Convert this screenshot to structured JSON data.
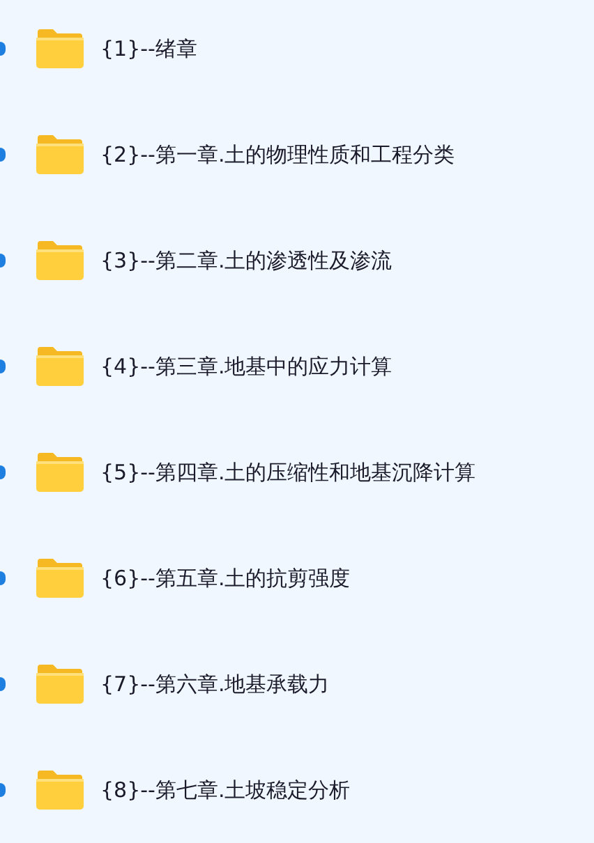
{
  "folders": [
    {
      "label": "{1}--绪章"
    },
    {
      "label": "{2}--第一章.土的物理性质和工程分类"
    },
    {
      "label": "{3}--第二章.土的渗透性及渗流"
    },
    {
      "label": "{4}--第三章.地基中的应力计算"
    },
    {
      "label": "{5}--第四章.土的压缩性和地基沉降计算"
    },
    {
      "label": "{6}--第五章.土的抗剪强度"
    },
    {
      "label": "{7}--第六章.地基承载力"
    },
    {
      "label": "{8}--第七章.土坡稳定分析"
    }
  ]
}
